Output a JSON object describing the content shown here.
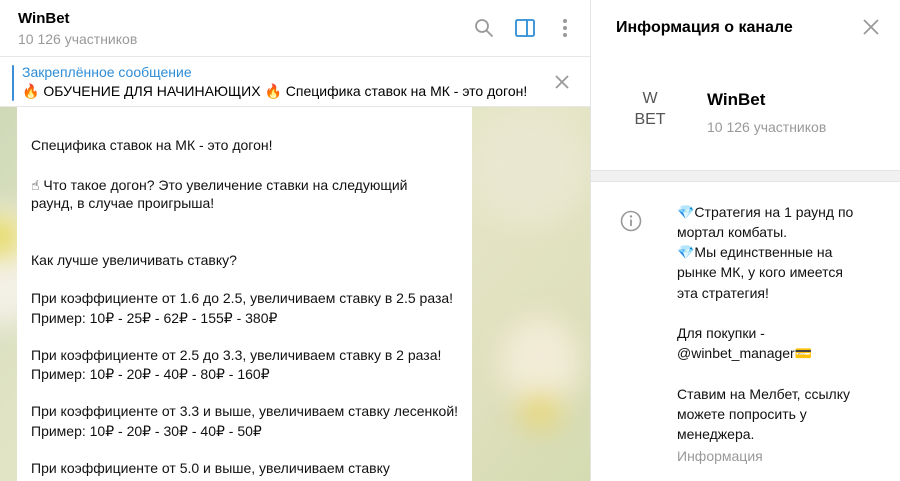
{
  "chat": {
    "title": "WinBet",
    "subtitle": "10 126 участников",
    "icons": [
      "search-icon",
      "sidebar-toggle-icon",
      "more-vertical-icon"
    ]
  },
  "pinned": {
    "label": "Закреплённое сообщение",
    "text": "🔥 ОБУЧЕНИЕ ДЛЯ НАЧИНАЮЩИХ 🔥   Специфика ставок на МК - это догон!"
  },
  "message": {
    "lines": [
      "Специфика ставок на МК - это догон!",
      "",
      "☝ Что такое догон? Это увеличение ставки на следующий",
      "раунд, в случае проигрыша!",
      "",
      "",
      "Как лучше увеличивать ставку?",
      "",
      "При коэффициенте от 1.6 до 2.5, увеличиваем ставку в 2.5 раза!",
      "Пример: 10₽ - 25₽ - 62₽ - 155₽ - 380₽",
      "",
      "При коэффициенте от 2.5 до 3.3, увеличиваем ставку в 2 раза!",
      "Пример: 10₽ - 20₽ - 40₽ - 80₽ - 160₽",
      "",
      "При коэффициенте от 3.3 и выше, увеличиваем ставку лесенкой!",
      "Пример: 10₽ - 20₽ - 30₽ - 40₽ - 50₽",
      "",
      "При коэффициенте от 5.0 и выше, увеличиваем ставку"
    ]
  },
  "info": {
    "header": "Информация о канале",
    "logo_line1": "W",
    "logo_line2": "BET",
    "name": "WinBet",
    "members": "10 126 участников",
    "description": [
      "💎Стратегия на 1 раунд по",
      "мортал комбаты.",
      "💎Мы единственные на",
      "рынке МК, у кого имеется",
      "эта стратегия!",
      "",
      "Для покупки -",
      "@winbet_manager💳",
      "",
      "Ставим на Мелбет, ссылку",
      "можете попросить у",
      "менеджера."
    ],
    "caption": "Информация"
  },
  "colors": {
    "accent": "#2e8dd6",
    "muted": "#999999"
  }
}
